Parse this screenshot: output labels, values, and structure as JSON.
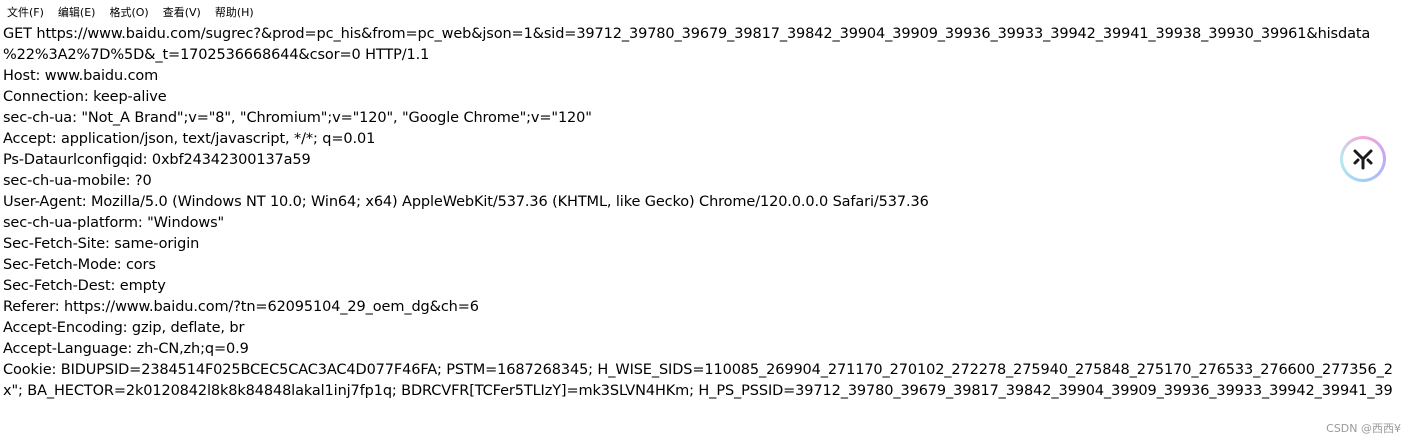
{
  "menubar": {
    "items": [
      {
        "label": "文件(F)"
      },
      {
        "label": "编辑(E)"
      },
      {
        "label": "格式(O)"
      },
      {
        "label": "查看(V)"
      },
      {
        "label": "帮助(H)"
      }
    ]
  },
  "editor": {
    "lines": [
      "GET https://www.baidu.com/sugrec?&prod=pc_his&from=pc_web&json=1&sid=39712_39780_39679_39817_39842_39904_39909_39936_39933_39942_39941_39938_39930_39961&hisdata",
      "%22%3A2%7D%5D&_t=1702536668644&csor=0 HTTP/1.1",
      "Host: www.baidu.com",
      "Connection: keep-alive",
      "sec-ch-ua: \"Not_A Brand\";v=\"8\", \"Chromium\";v=\"120\", \"Google Chrome\";v=\"120\"",
      "Accept: application/json, text/javascript, */*; q=0.01",
      "Ps-Dataurlconfigqid: 0xbf24342300137a59",
      "sec-ch-ua-mobile: ?0",
      "User-Agent: Mozilla/5.0 (Windows NT 10.0; Win64; x64) AppleWebKit/537.36 (KHTML, like Gecko) Chrome/120.0.0.0 Safari/537.36",
      "sec-ch-ua-platform: \"Windows\"",
      "Sec-Fetch-Site: same-origin",
      "Sec-Fetch-Mode: cors",
      "Sec-Fetch-Dest: empty",
      "Referer: https://www.baidu.com/?tn=62095104_29_oem_dg&ch=6",
      "Accept-Encoding: gzip, deflate, br",
      "Accept-Language: zh-CN,zh;q=0.9",
      "Cookie: BIDUPSID=2384514F025BCEC5CAC3AC4D077F46FA; PSTM=1687268345; H_WISE_SIDS=110085_269904_271170_270102_272278_275940_275848_275170_276533_276600_277356_2",
      "x\"; BA_HECTOR=2k0120842l8k8k84848lakal1inj7fp1q; BDRCVFR[TCFer5TLIzY]=mk3SLVN4HKm; H_PS_PSSID=39712_39780_39679_39817_39842_39904_39909_39936_39933_39942_39941_39"
    ]
  },
  "watermark": {
    "text": "CSDN @西西¥"
  },
  "floating_badge": {
    "icon": "fork-logo-icon"
  }
}
